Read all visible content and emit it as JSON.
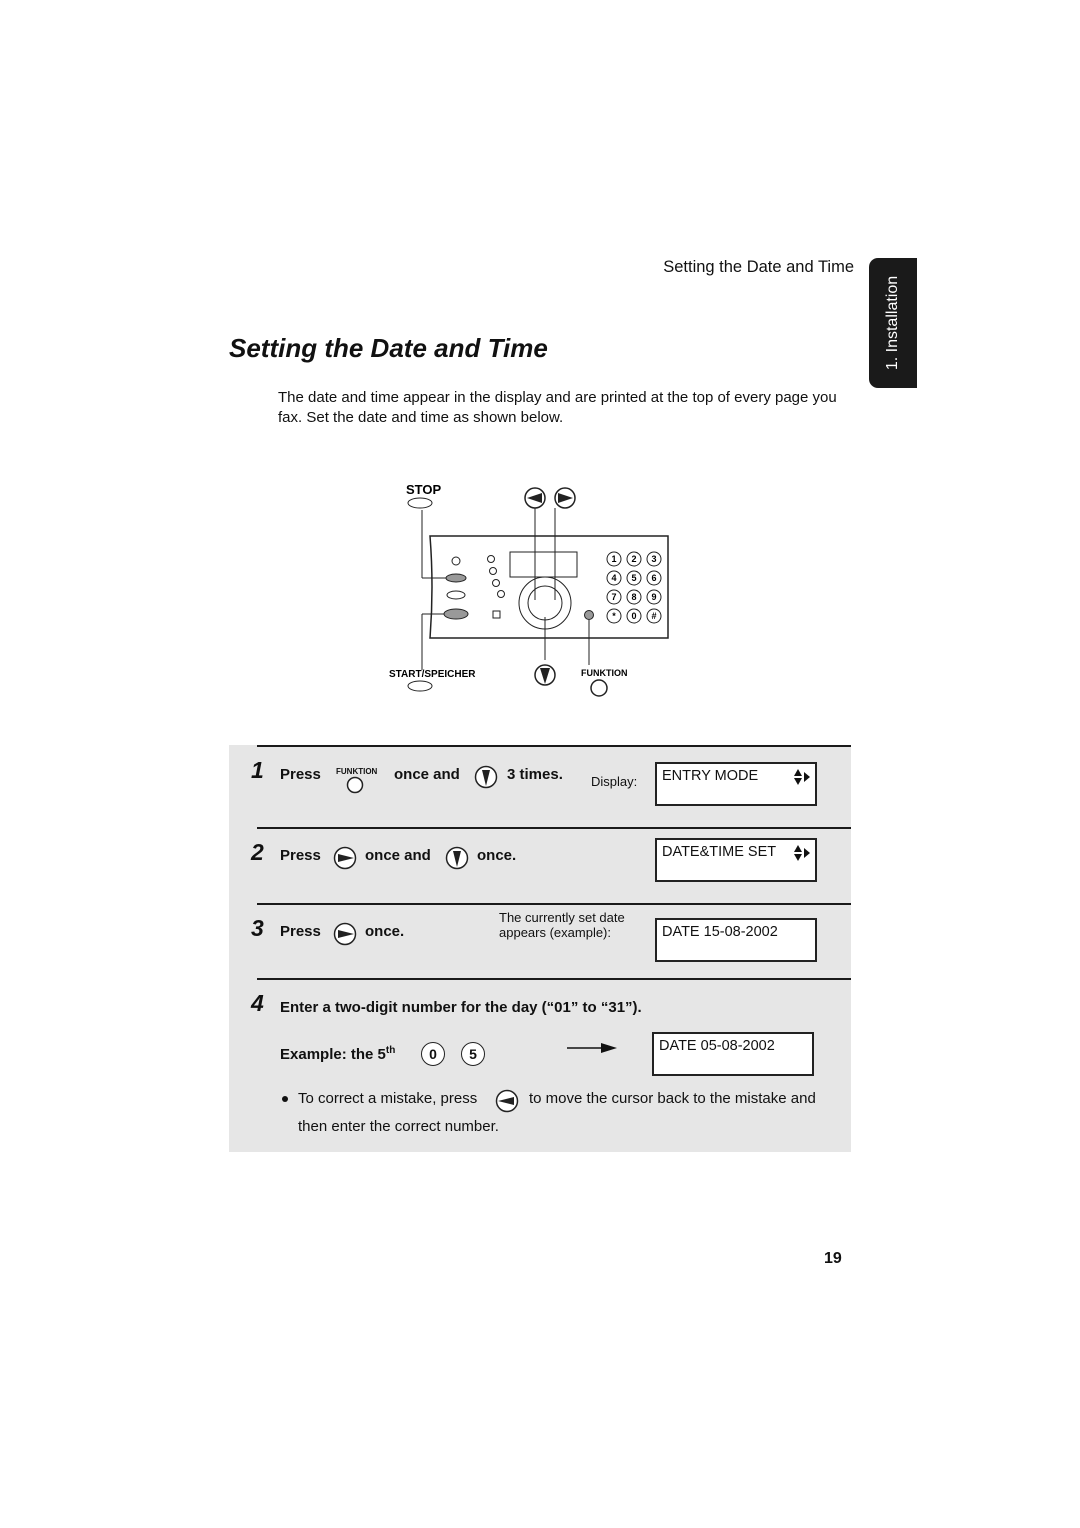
{
  "header": {
    "running_title": "Setting the Date and Time",
    "section_tab": "1. Installation"
  },
  "title": "Setting the Date and Time",
  "intro": "The date and time appear in the display and are printed at the top of every page you fax. Set the date and time as shown below.",
  "diagram": {
    "stop_label": "STOP",
    "start_label": "START/SPEICHER",
    "funktion_label": "FUNKTION",
    "keypad": [
      "1",
      "2",
      "3",
      "4",
      "5",
      "6",
      "7",
      "8",
      "9",
      "*",
      "0",
      "#"
    ]
  },
  "steps": [
    {
      "number": "1",
      "parts": [
        "Press",
        "FUNKTION",
        "once and",
        "3 times."
      ],
      "display_label": "Display:",
      "display": "ENTRY MODE"
    },
    {
      "number": "2",
      "parts": [
        "Press",
        "once and",
        "once."
      ],
      "display": "DATE&TIME SET"
    },
    {
      "number": "3",
      "parts": [
        "Press",
        "once."
      ],
      "note": [
        "The currently set date",
        "appears (example):"
      ],
      "display": "DATE 15-08-2002"
    },
    {
      "number": "4",
      "instruction": "Enter a two-digit number for the day (“01” to “31”).",
      "example_label": "Example: the 5",
      "example_sup": "th",
      "example_keys": [
        "0",
        "5"
      ],
      "display": "DATE 05-08-2002",
      "bullet_a": "To correct a mistake, press",
      "bullet_b": "to move the cursor back to the mistake and",
      "bullet_c": "then enter the correct number."
    }
  ],
  "page_number": "19"
}
